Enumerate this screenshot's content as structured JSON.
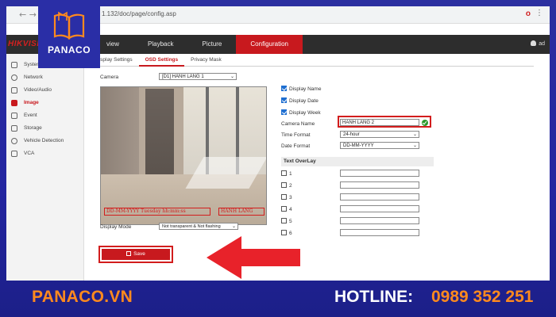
{
  "browser": {
    "url": "1.132/doc/page/config.asp",
    "nav_glyphs": "←  →  C"
  },
  "header": {
    "brand": "HIKVISION",
    "tabs": [
      {
        "label": "view"
      },
      {
        "label": "Playback"
      },
      {
        "label": "Picture"
      },
      {
        "label": "Configuration"
      }
    ],
    "user": "ad"
  },
  "sidebar": {
    "items": [
      {
        "label": "System"
      },
      {
        "label": "Network"
      },
      {
        "label": "Video/Audio"
      },
      {
        "label": "Image"
      },
      {
        "label": "Event"
      },
      {
        "label": "Storage"
      },
      {
        "label": "Vehicle Detection"
      },
      {
        "label": "VCA"
      }
    ]
  },
  "subtabs": [
    {
      "label": "Display Settings"
    },
    {
      "label": "OSD Settings"
    },
    {
      "label": "Privacy Mask"
    }
  ],
  "form": {
    "camera_label": "Camera",
    "camera_value": "[D1] HANH LANG 1",
    "display_name": "Display Name",
    "display_date": "Display Date",
    "display_week": "Display Week",
    "camera_name_label": "Camera Name",
    "camera_name_value": "HANH LANG 2",
    "time_format_label": "Time Format",
    "time_format_value": "24-hour",
    "date_format_label": "Date Format",
    "date_format_value": "DD-MM-YYYY",
    "text_overlay_label": "Text OverLay",
    "overlay_items": [
      "1",
      "2",
      "3",
      "4",
      "5",
      "6"
    ],
    "display_mode_label": "Display Mode",
    "display_mode_value": "Not transparent & Not flashing",
    "save_label": "Save"
  },
  "preview": {
    "osd_date": "DD-MM-YYYY Tuesday hh:mm:ss",
    "osd_name": "HANH LANG"
  },
  "branding": {
    "logo_text": "PANACO",
    "website": "PANACO.VN",
    "hotline_label": "HOTLINE:",
    "hotline_number": "0989 352 251"
  },
  "colors": {
    "accent": "#c8191e",
    "frame": "#2a2d9a",
    "footer_orange": "#ff8a1e"
  }
}
